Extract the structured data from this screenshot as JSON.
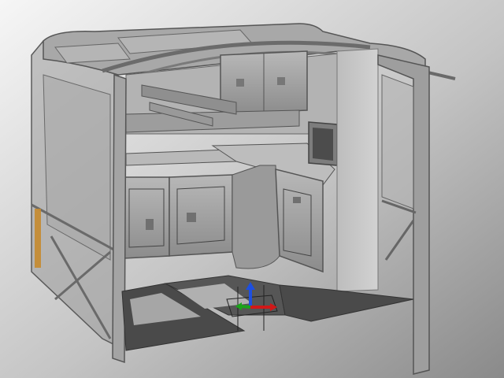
{
  "viewport": {
    "background_light": "#f4f4f4",
    "background_dark": "#8e8e8e",
    "model_color": "#a9a9a9",
    "panel_color": "#8f8f8f",
    "floor_color": "#4a4a4a",
    "accent_color": "#c58a2e"
  },
  "gizmo": {
    "x_axis_color": "#d11818",
    "y_axis_color": "#1aa31a",
    "z_axis_color": "#1d4fe0"
  },
  "icons": [
    "transform-gizmo-icon"
  ]
}
